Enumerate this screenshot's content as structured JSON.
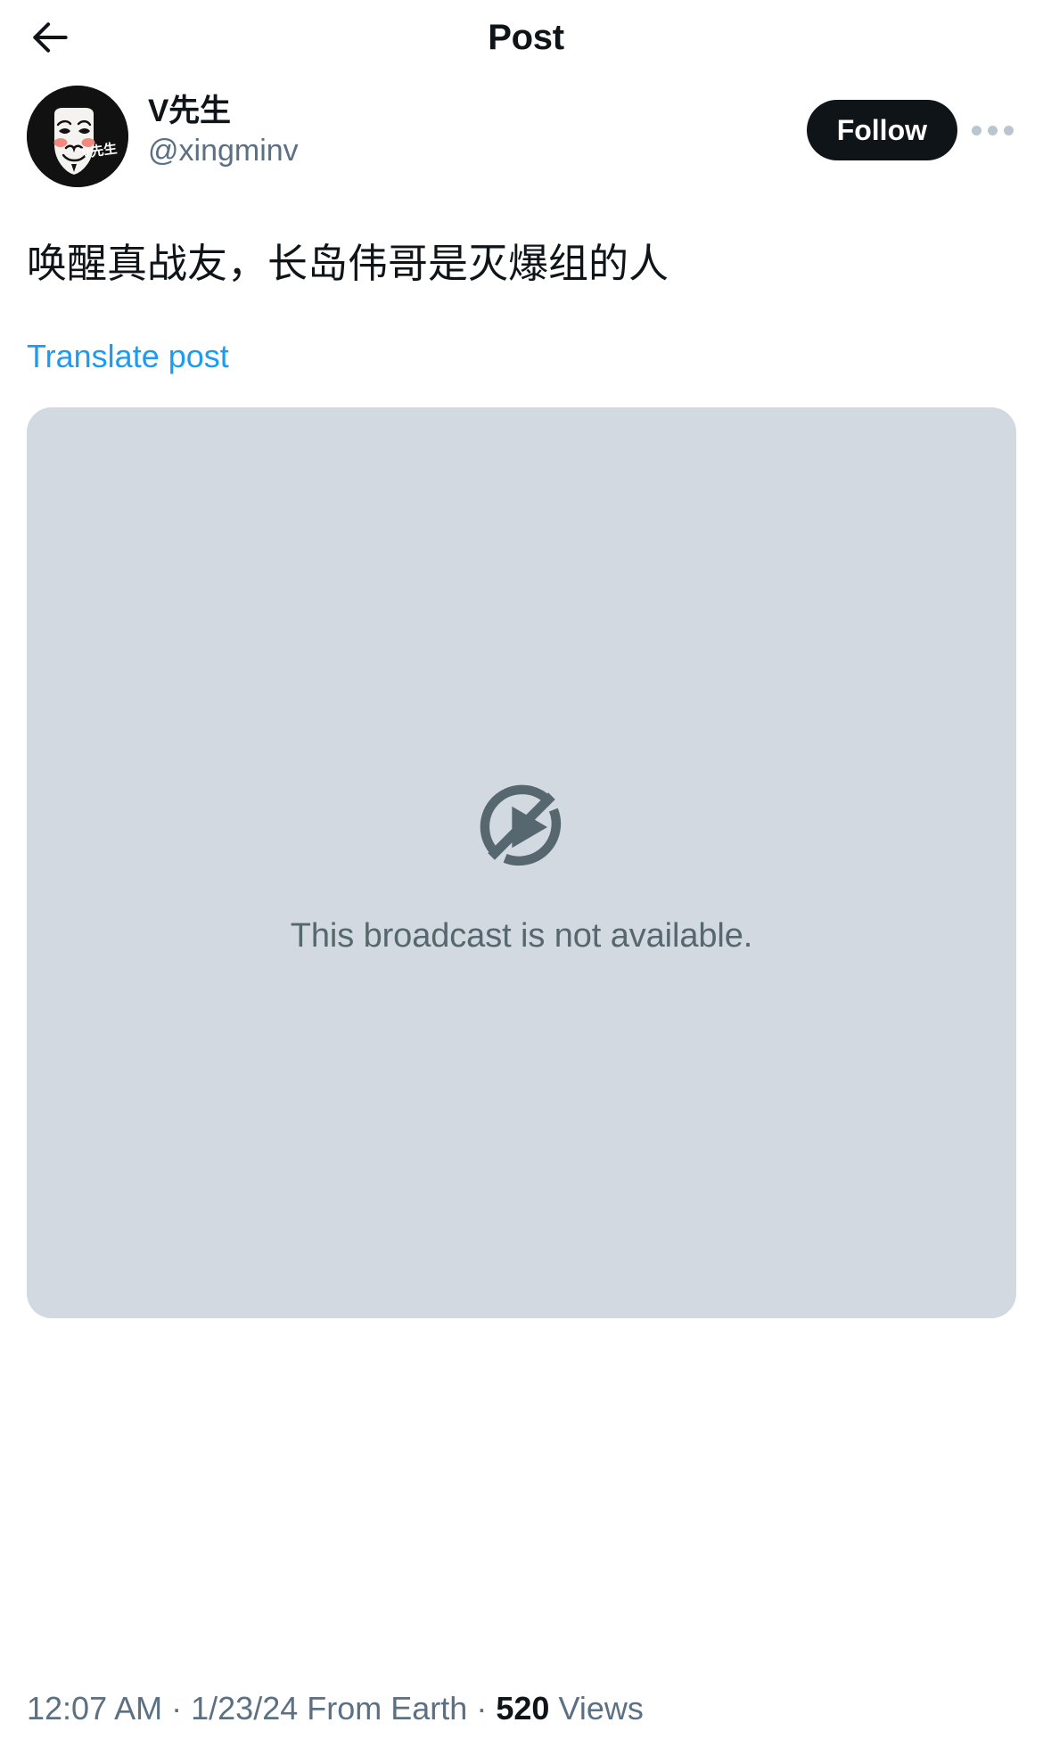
{
  "header": {
    "title": "Post",
    "back_icon": "arrow-left-icon"
  },
  "author": {
    "display_name": "V先生",
    "handle": "@xingminv",
    "avatar_alt": "guy-fawkes-mask-avatar",
    "avatar_badge_text": "V先生",
    "follow_label": "Follow",
    "more_icon": "more-horizontal-icon"
  },
  "post": {
    "text": "唤醒真战友，长岛伟哥是灭爆组的人",
    "translate_label": "Translate post"
  },
  "media": {
    "icon": "play-circle-slash-icon",
    "message": "This broadcast is not available."
  },
  "meta": {
    "time": "12:07 AM",
    "separator_1": "·",
    "date": "1/23/24",
    "source": "From Earth",
    "separator_2": "·",
    "views_count": "520",
    "views_label": "Views"
  },
  "colors": {
    "link": "#1d9bf0",
    "text_primary": "#0f1419",
    "text_secondary": "#5b7083",
    "media_bg": "#d2d9e0",
    "media_fg": "#56676e",
    "follow_bg": "#0f1419"
  }
}
